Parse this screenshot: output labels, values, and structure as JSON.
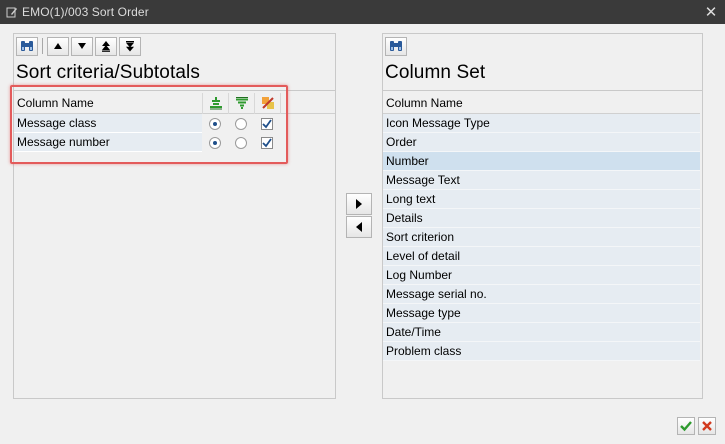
{
  "window": {
    "title": "EMO(1)/003 Sort Order",
    "close_glyph": "✕"
  },
  "left": {
    "heading": "Sort criteria/Subtotals",
    "table": {
      "header": "Column Name",
      "icon_columns": [
        "sort-ascending-icon",
        "sort-descending-icon",
        "subtotal-icon"
      ],
      "rows": [
        {
          "name": "Message class",
          "ascending": true,
          "descending": false,
          "subtotal": true
        },
        {
          "name": "Message number",
          "ascending": true,
          "descending": false,
          "subtotal": true
        }
      ]
    }
  },
  "right": {
    "heading": "Column Set",
    "table": {
      "header": "Column Name",
      "selected_index": 2,
      "rows": [
        "Icon Message Type",
        "Order",
        "Number",
        "Message Text",
        "Long text",
        "Details",
        "Sort criterion",
        "Level of detail",
        "Log Number",
        "Message serial no.",
        "Message type",
        "Date/Time",
        "Problem class"
      ]
    }
  },
  "colors": {
    "highlight_border": "#e35b5b",
    "row_background": "#e6ecf2",
    "row_selected": "#cfe0ee",
    "ok_green": "#2e9a2e",
    "cancel_red": "#d23a1e"
  }
}
